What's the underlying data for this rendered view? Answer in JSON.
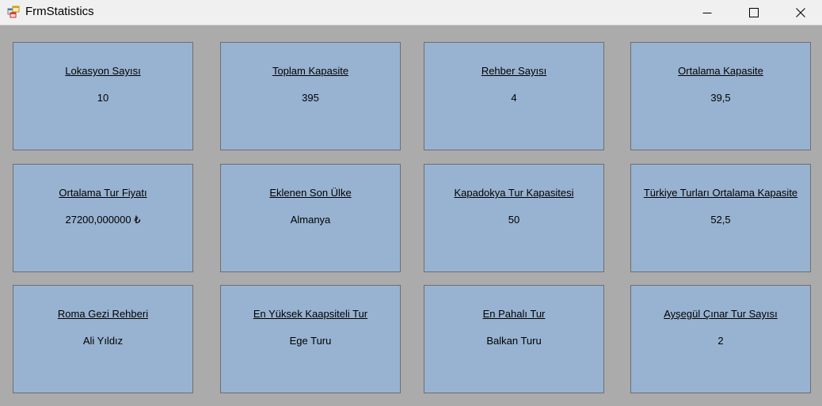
{
  "window": {
    "title": "FrmStatistics"
  },
  "cards": [
    {
      "title": "Lokasyon Sayısı",
      "value": "10"
    },
    {
      "title": "Toplam Kapasite",
      "value": "395"
    },
    {
      "title": "Rehber Sayısı",
      "value": "4"
    },
    {
      "title": "Ortalama Kapasite",
      "value": "39,5"
    },
    {
      "title": "Ortalama Tur Fiyatı",
      "value": "27200,000000 ₺"
    },
    {
      "title": "Eklenen Son Ülke",
      "value": "Almanya"
    },
    {
      "title": "Kapadokya Tur Kapasitesi",
      "value": "50"
    },
    {
      "title": "Türkiye Turları Ortalama Kapasite",
      "value": "52,5"
    },
    {
      "title": "Roma Gezi Rehberi",
      "value": "Ali Yıldız"
    },
    {
      "title": "En Yüksek Kaapsiteli Tur",
      "value": "Ege Turu"
    },
    {
      "title": "En Pahalı Tur",
      "value": "Balkan Turu"
    },
    {
      "title": "Ayşegül Çınar Tur Sayısı",
      "value": "2"
    }
  ]
}
